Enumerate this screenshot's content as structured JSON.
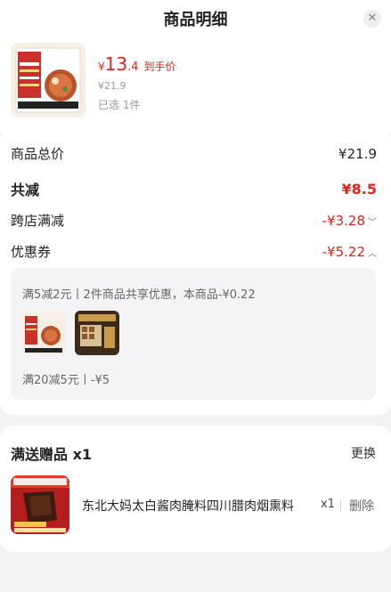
{
  "header": {
    "title": "商品明细"
  },
  "product": {
    "price_yen": "¥",
    "price_int": "13",
    "price_dec": ".4",
    "price_tag": "到手价",
    "original_price": "¥21.9",
    "selected_text": "已选 1件"
  },
  "summary": {
    "total_label": "商品总价",
    "total_value": "¥21.9",
    "discount_label": "共减",
    "discount_value": "¥8.5",
    "cross_store_label": "跨店满减",
    "cross_store_value": "-¥3.28",
    "coupon_label": "优惠券",
    "coupon_value": "-¥5.22"
  },
  "coupon_detail": {
    "line1": "满5减2元丨2件商品共享优惠，本商品-¥0.22",
    "line2": "满20减5元丨-¥5"
  },
  "gift": {
    "title": "满送赠品 x1",
    "change_label": "更换",
    "name": "东北大妈太白酱肉腌料四川腊肉烟熏料",
    "qty": "x1",
    "delete_label": "删除"
  },
  "colors": {
    "accent": "#e2231a"
  }
}
